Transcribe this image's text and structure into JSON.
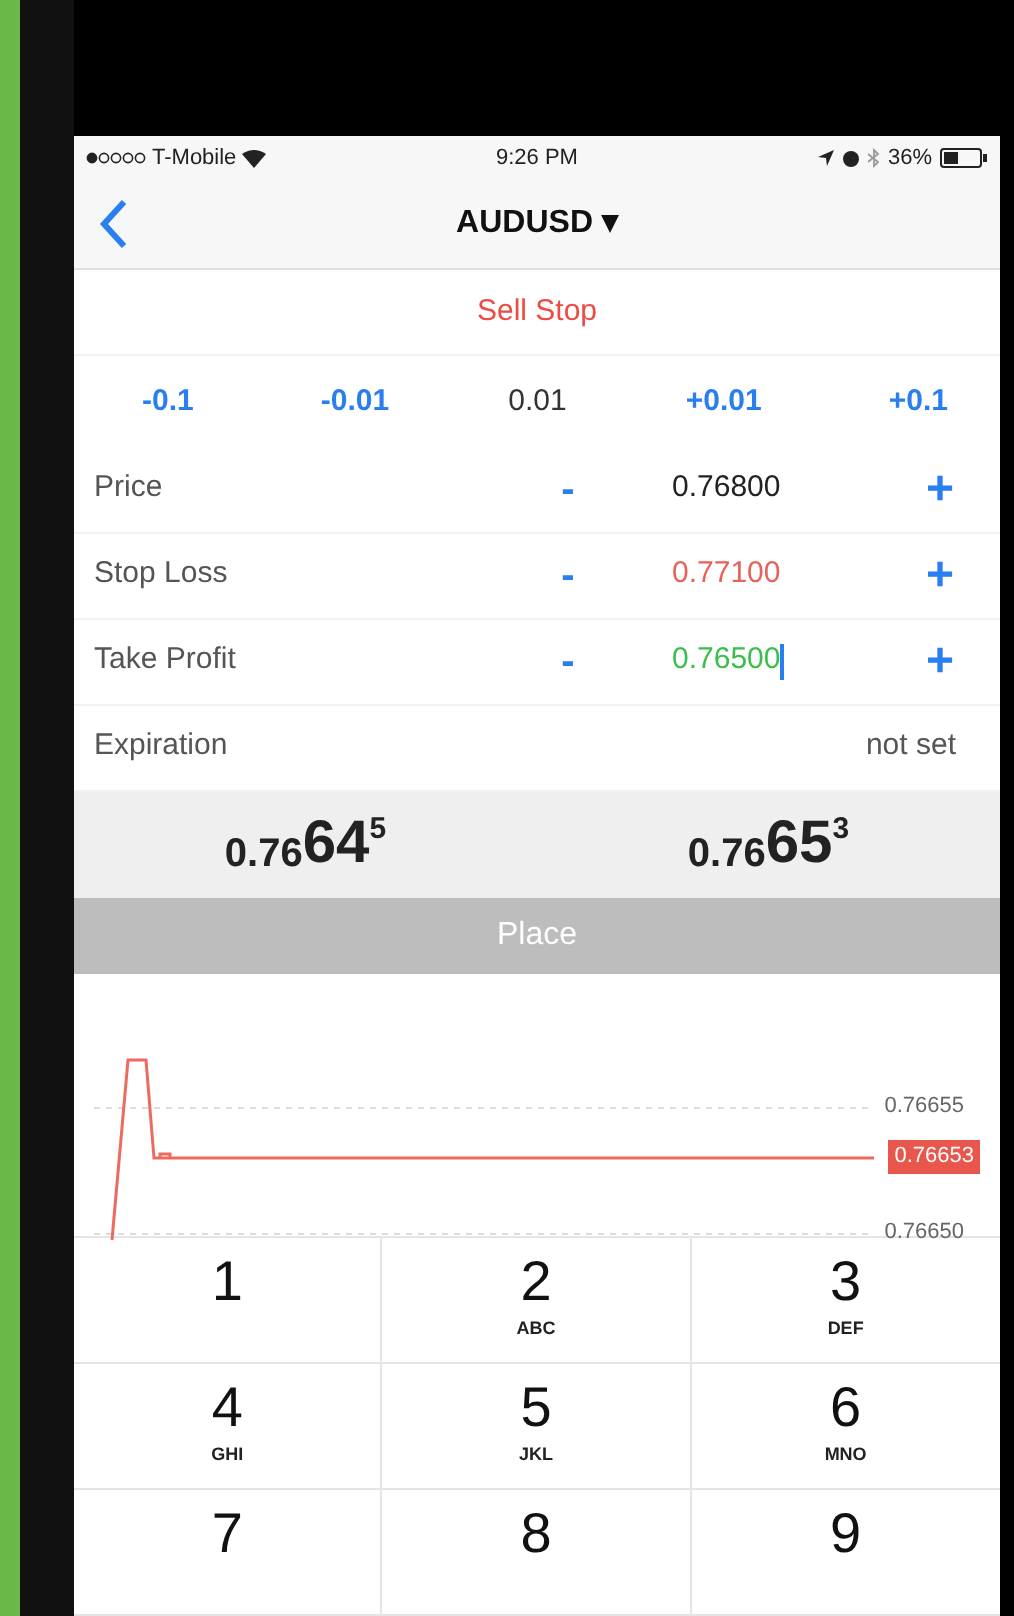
{
  "status_bar": {
    "carrier": "T-Mobile",
    "time": "9:26 PM",
    "battery": "36%"
  },
  "nav": {
    "title": "AUDUSD ▾"
  },
  "order_type": "Sell Stop",
  "volume_steps": [
    {
      "kind": "step",
      "label": "-0.1"
    },
    {
      "kind": "step",
      "label": "-0.01"
    },
    {
      "kind": "value",
      "label": "0.01"
    },
    {
      "kind": "step",
      "label": "+0.01"
    },
    {
      "kind": "step",
      "label": "+0.1"
    }
  ],
  "fields": [
    {
      "kind": "stepper",
      "label": "Price",
      "value": "0.76800",
      "color": "#222222",
      "minus": "-",
      "plus": "+",
      "focused": false
    },
    {
      "kind": "stepper",
      "label": "Stop Loss",
      "value": "0.77100",
      "color": "#e8625a",
      "minus": "-",
      "plus": "+",
      "focused": false
    },
    {
      "kind": "stepper",
      "label": "Take Profit",
      "value": "0.76500",
      "color": "#3cbf4a",
      "minus": "-",
      "plus": "+",
      "focused": true
    },
    {
      "kind": "text",
      "label": "Expiration",
      "value": "not set"
    }
  ],
  "quotes": [
    {
      "small": "0.76",
      "big": "64",
      "sup": "5"
    },
    {
      "small": "0.76",
      "big": "65",
      "sup": "3"
    }
  ],
  "place_button": {
    "label": "Place",
    "disabled": true
  },
  "chart": {
    "ticks": [
      "0.76655",
      "0.76650"
    ],
    "current": "0.76653"
  },
  "keypad": [
    {
      "digit": "1"
    },
    {
      "digit": "2",
      "letters": "ABC"
    },
    {
      "digit": "3",
      "letters": "DEF"
    },
    {
      "digit": "4",
      "letters": "GHI"
    },
    {
      "digit": "5",
      "letters": "JKL"
    },
    {
      "digit": "6",
      "letters": "MNO"
    },
    {
      "digit": "7"
    },
    {
      "digit": "8"
    },
    {
      "digit": "9"
    }
  ]
}
